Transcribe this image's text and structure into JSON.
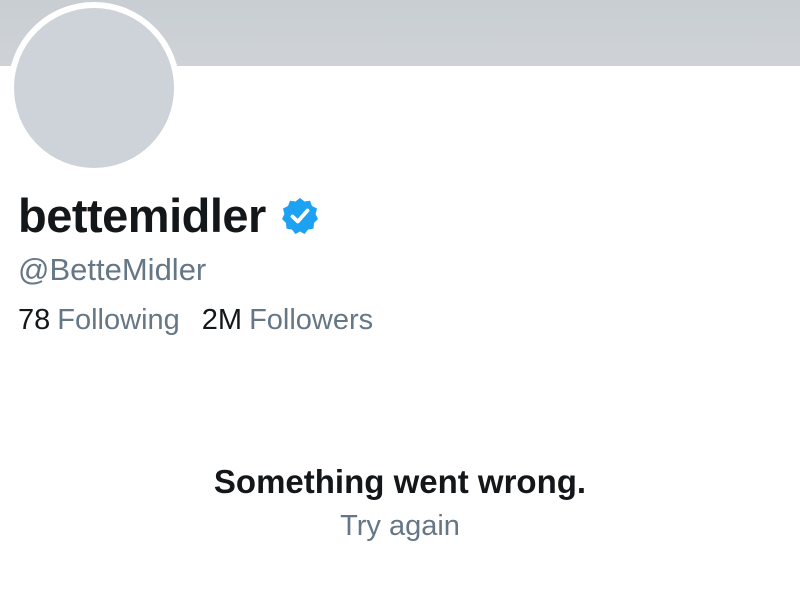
{
  "profile": {
    "display_name": "bettemidler",
    "handle": "@BetteMidler",
    "verified_icon": "verified-badge-icon",
    "following_count": "78",
    "following_label": "Following",
    "followers_count": "2M",
    "followers_label": "Followers"
  },
  "error": {
    "message": "Something went wrong.",
    "retry_label": "Try again"
  },
  "colors": {
    "banner": "#cfd3d7",
    "avatar": "#cdd3d9",
    "verified": "#1da1f2",
    "primary_text": "#14171a",
    "secondary_text": "#657786"
  }
}
